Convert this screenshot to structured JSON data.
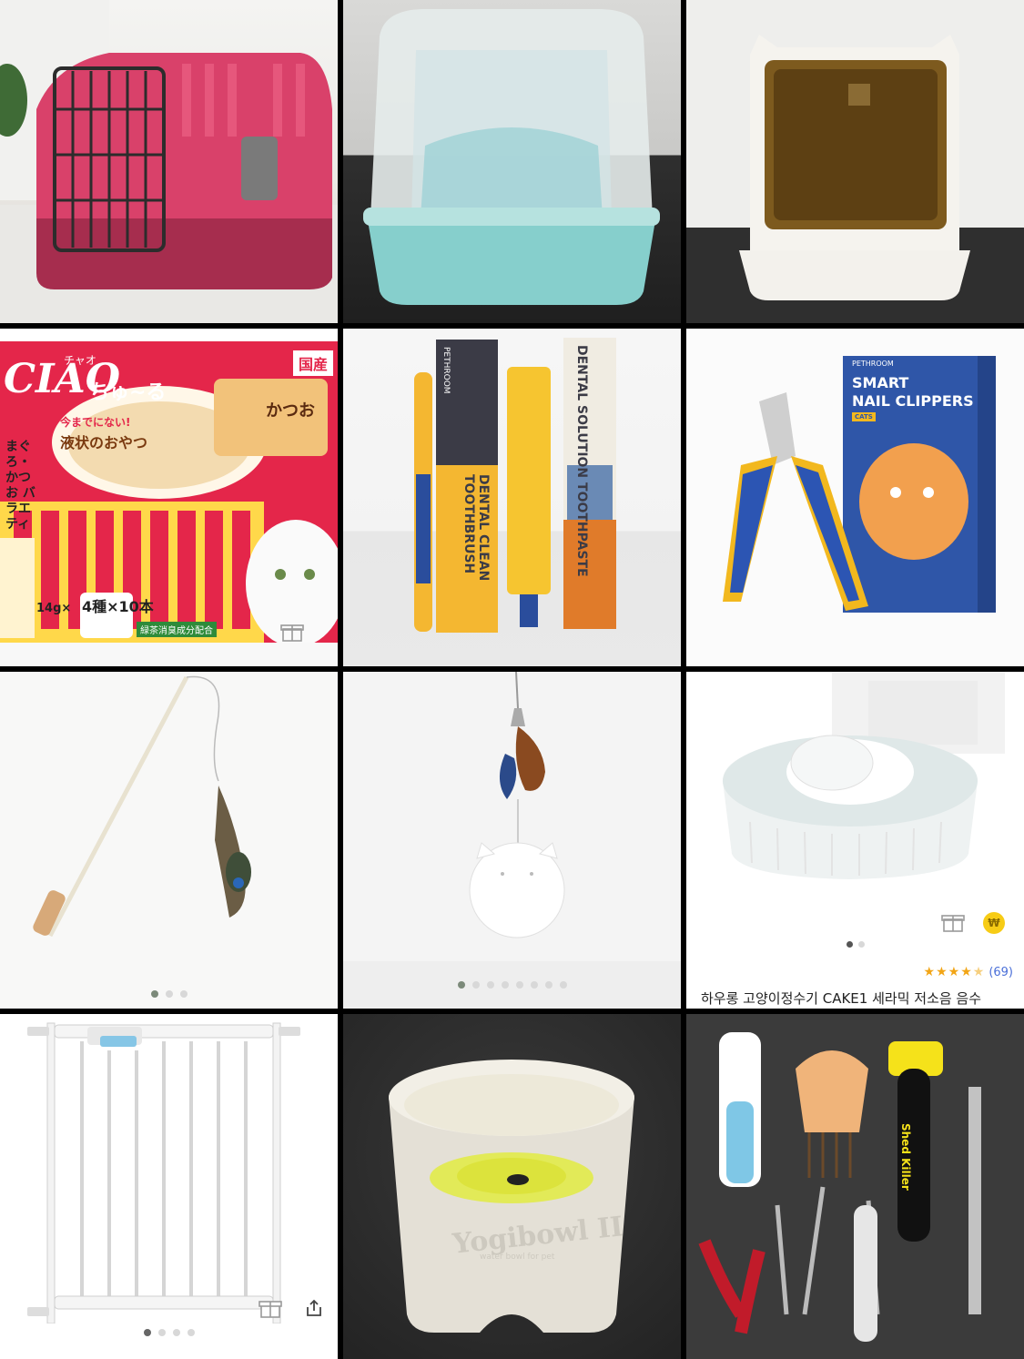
{
  "grid": {
    "tiles": [
      {
        "name": "pet-carrier",
        "photo": "pink plastic pet carrier"
      },
      {
        "name": "hooded-litter-box",
        "photo": "mint hooded litter box"
      },
      {
        "name": "white-litter-box",
        "photo": "white hooded litter box with cat ears"
      },
      {
        "name": "ciao-churu-treats",
        "photo": "CIAO churu treat box"
      },
      {
        "name": "dental-kit",
        "photo": "dental toothpaste and toothbrush"
      },
      {
        "name": "nail-clippers",
        "photo": "smart nail clippers"
      },
      {
        "name": "feather-wand",
        "photo": "feather wand toy"
      },
      {
        "name": "feather-ball-toy",
        "photo": "electric feather ball toy"
      },
      {
        "name": "water-fountain",
        "photo": "ceramic cat water fountain"
      },
      {
        "name": "pet-gate",
        "photo": "white pet safety gate"
      },
      {
        "name": "yogibowl",
        "photo": "Yogibowl II water bowl"
      },
      {
        "name": "grooming-kit",
        "photo": "grooming tools set"
      }
    ]
  },
  "packaging": {
    "ciao_brand": "CIAO",
    "ciao_kana": "チャオ",
    "ciao_churu": "ちゅ~る",
    "ciao_made": "国産",
    "ciao_flavor": "かつお",
    "ciao_tagline_1": "今までにない!",
    "ciao_tagline_2": "液状のおやつ",
    "ciao_variety": "まぐろ・かつお バラエティ",
    "ciao_count": "4種×10本",
    "ciao_weight": "14g×",
    "ciao_green_tea": "緑茶消臭成分配合",
    "dental_paste": "DENTAL SOLUTION TOOTHPASTE",
    "dental_brush": "DENTAL CLEAN TOOTHBRUSH",
    "dental_brand": "PETHROOM",
    "clipper_brand": "PETHROOM",
    "clipper_title_1": "SMART",
    "clipper_title_2": "NAIL CLIPPERS",
    "clipper_tag": "CATS",
    "yogibowl_logo": "Yogibowl II",
    "yogibowl_sub": "water bowl for pet",
    "shed_killer": "Shed Killer"
  },
  "water_fountain": {
    "title": "하우롱 고양이정수기 CAKE1 세라믹 저소음 음수",
    "rating_stars": 4.5,
    "review_count": "(69)",
    "badge": "₩",
    "carousel_dots": 2,
    "carousel_index": 0
  },
  "feather_wand": {
    "carousel_dots": 3,
    "carousel_index": 0
  },
  "feather_ball": {
    "carousel_dots": 8,
    "carousel_index": 0
  },
  "pet_gate": {
    "carousel_dots": 4,
    "carousel_index": 0
  },
  "colors": {
    "dot_active": "#7c8a7a",
    "dot_inactive": "#d8d8d8",
    "star": "#f2a516",
    "review_link": "#4a6fd8",
    "coin_badge": "#f7cc16"
  },
  "icons": [
    "gift-icon",
    "share-icon",
    "won-coin-icon",
    "star-icon"
  ]
}
